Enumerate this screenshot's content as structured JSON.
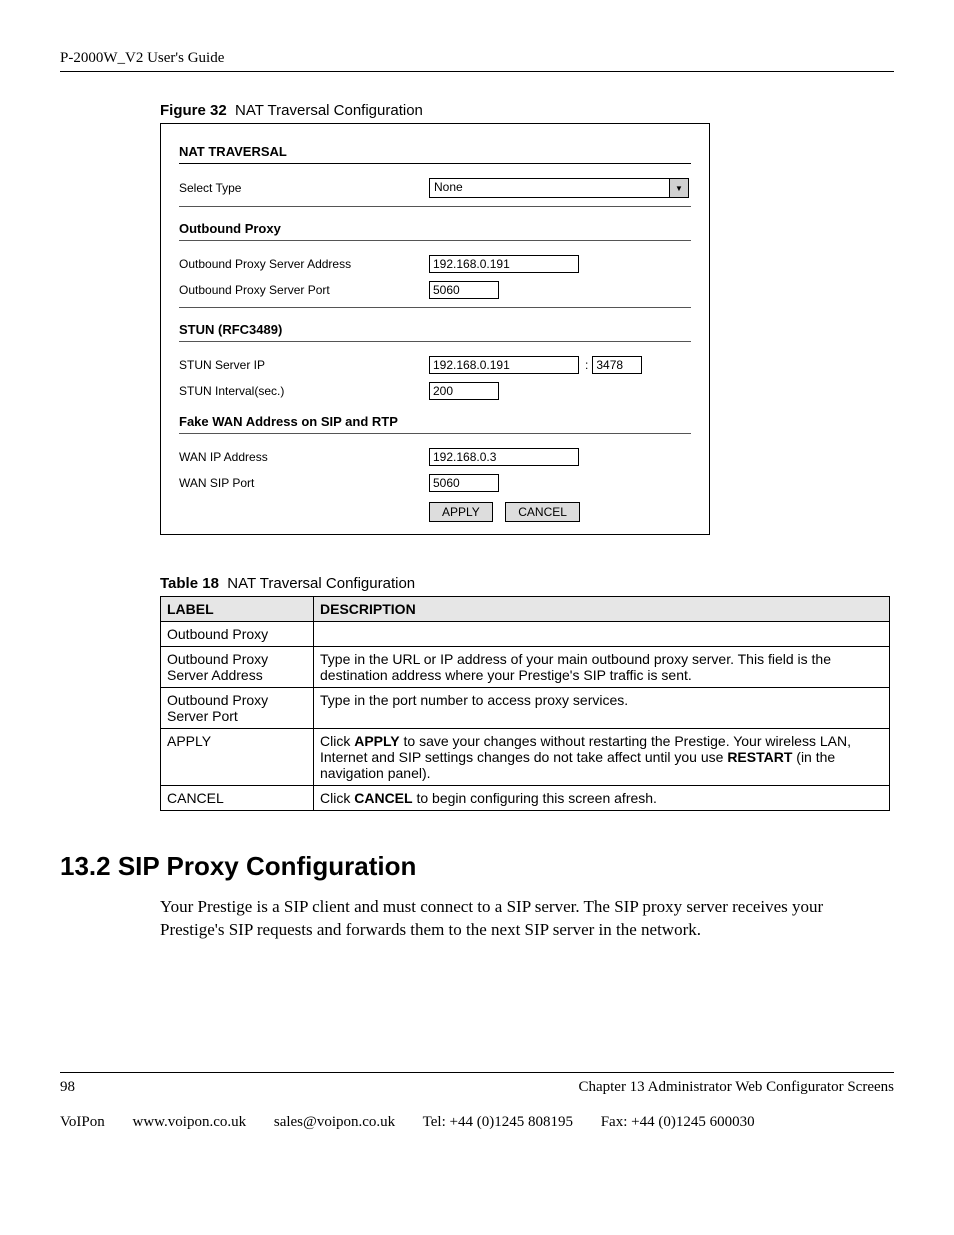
{
  "header": {
    "doc_title": "P-2000W_V2 User's Guide"
  },
  "figure": {
    "caption_label": "Figure 32",
    "caption_text": "NAT Traversal Configuration",
    "nat_title": "NAT TRAVERSAL",
    "select_type_label": "Select Type",
    "select_type_value": "None",
    "outbound_title": "Outbound Proxy",
    "op_addr_label": "Outbound Proxy Server Address",
    "op_addr_value": "192.168.0.191",
    "op_port_label": "Outbound Proxy Server Port",
    "op_port_value": "5060",
    "stun_title": "STUN (RFC3489)",
    "stun_ip_label": "STUN Server IP",
    "stun_ip_value": "192.168.0.191",
    "stun_port_value": "3478",
    "stun_interval_label": "STUN Interval(sec.)",
    "stun_interval_value": "200",
    "fake_title": "Fake WAN Address on SIP and RTP",
    "wan_ip_label": "WAN IP Address",
    "wan_ip_value": "192.168.0.3",
    "wan_port_label": "WAN SIP Port",
    "wan_port_value": "5060",
    "apply_btn": "APPLY",
    "cancel_btn": "CANCEL"
  },
  "table": {
    "caption_label": "Table 18",
    "caption_text": "NAT Traversal Configuration",
    "head_label": "LABEL",
    "head_desc": "DESCRIPTION",
    "rows": [
      {
        "label": "Outbound Proxy",
        "desc": ""
      },
      {
        "label": "Outbound Proxy Server Address",
        "desc": "Type in the URL or IP address of your main outbound proxy server. This field is the destination address where your Prestige's SIP traffic is sent."
      },
      {
        "label": "Outbound Proxy Server Port",
        "desc": "Type in the port number to access proxy services."
      },
      {
        "label": "APPLY",
        "desc_pre": "Click ",
        "desc_b1": "APPLY",
        "desc_mid": " to save your changes without restarting the Prestige. Your wireless LAN, Internet and SIP settings changes do not take affect until you use ",
        "desc_b2": "RESTART",
        "desc_post": " (in the navigation panel)."
      },
      {
        "label": "CANCEL",
        "desc_pre": "Click ",
        "desc_b1": "CANCEL",
        "desc_post": " to begin configuring this screen afresh."
      }
    ]
  },
  "section": {
    "heading": "13.2  SIP Proxy Configuration",
    "body": "Your Prestige is a SIP client and must connect to a SIP server. The SIP proxy server receives your Prestige's SIP requests and forwards them to the next SIP server in the network."
  },
  "footer": {
    "page_num": "98",
    "chapter": "Chapter 13 Administrator Web Configurator Screens",
    "company": "VoIPon",
    "url": "www.voipon.co.uk",
    "email": "sales@voipon.co.uk",
    "tel": "Tel: +44 (0)1245 808195",
    "fax": "Fax: +44 (0)1245 600030"
  }
}
